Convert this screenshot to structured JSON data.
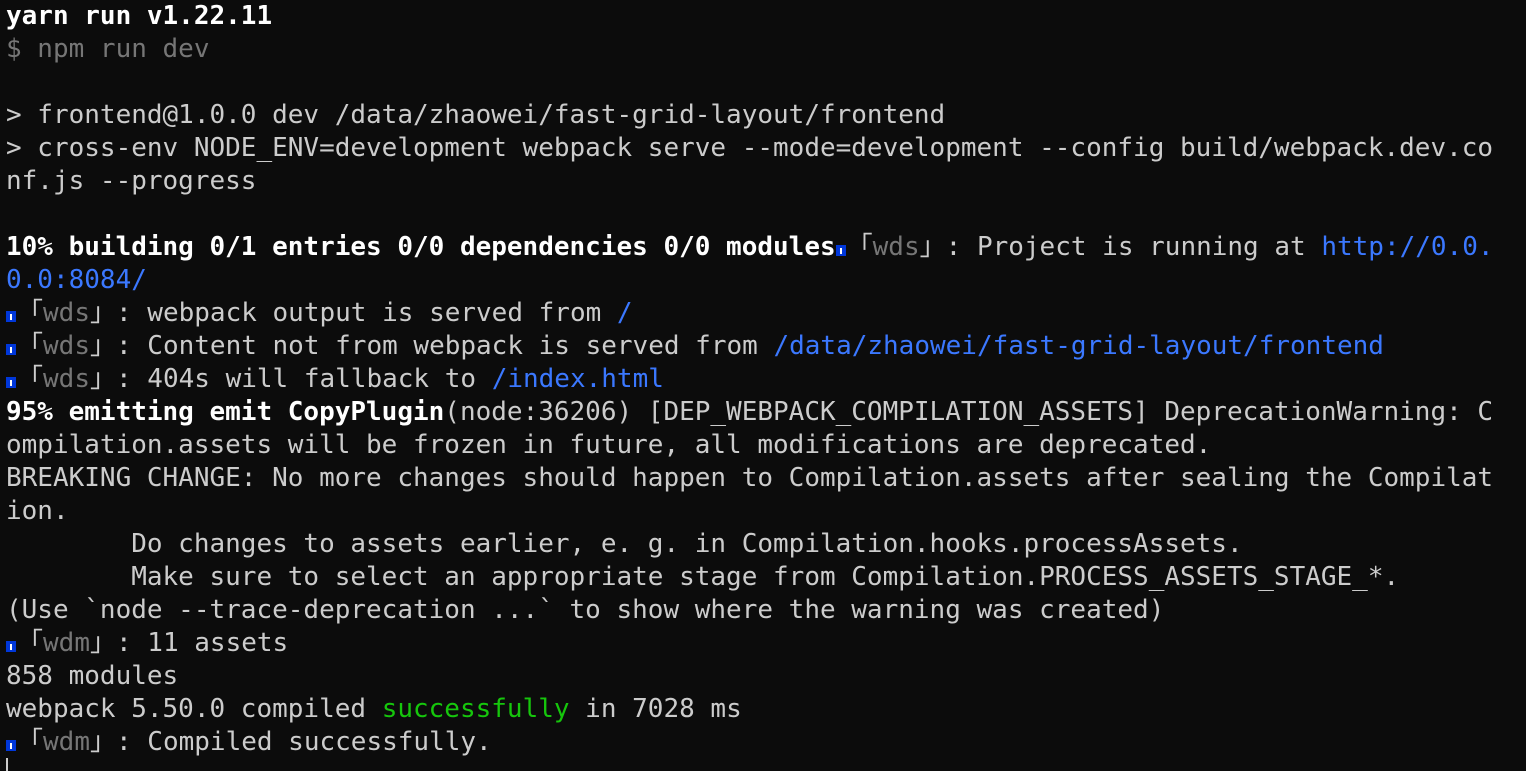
{
  "terminal": {
    "colors": {
      "background": "#0c0c0c",
      "text": "#cccccc",
      "link": "#3b78ff",
      "success": "#16c60c",
      "info_badge": "#0037da",
      "dim": "#767676"
    },
    "line1": "yarn run v1.22.11",
    "line2": "$ npm run dev",
    "line3": "> frontend@1.0.0 dev /data/zhaowei/fast-grid-layout/frontend",
    "line4": "> cross-env NODE_ENV=development webpack serve --mode=development --config build/webpack.dev.co",
    "line5": "nf.js --progress",
    "build_progress": "10% building 0/1 entries 0/0 dependencies 0/0 modules",
    "wds_tag": "wds",
    "wdm_tag": "wdm",
    "tag_open": "「",
    "tag_close": "」",
    "project_running_text": ": Project is running at ",
    "project_url_part1": "http://0.0.",
    "project_url_part2": "0.0:8084/",
    "served_from_text": ": webpack output is served from ",
    "served_from_path": "/",
    "content_text": ": Content not from webpack is served from ",
    "content_path": "/data/zhaowei/fast-grid-layout/frontend",
    "fallback_text": ": 404s will fallback to ",
    "fallback_path": "/index.html",
    "emit_prefix": "95% emitting emit CopyPlugin",
    "emit_rest": "(node:36206) [DEP_WEBPACK_COMPILATION_ASSETS] DeprecationWarning: C",
    "deprecation_line2": "ompilation.assets will be frozen in future, all modifications are deprecated.",
    "breaking_line1": "BREAKING CHANGE: No more changes should happen to Compilation.assets after sealing the Compilat",
    "breaking_line2": "ion.",
    "advice1": "        Do changes to assets earlier, e. g. in Compilation.hooks.processAssets.",
    "advice2": "        Make sure to select an appropriate stage from Compilation.PROCESS_ASSETS_STAGE_*.",
    "trace_line": "(Use `node --trace-deprecation ...` to show where the warning was created)",
    "assets_text": ": 11 assets",
    "modules_line": "858 modules",
    "compiled_prefix": "webpack 5.50.0 compiled ",
    "compiled_status": "successfully",
    "compiled_suffix": " in 7028 ms",
    "compiled_final": ": Compiled successfully.",
    "info_icon": "info-icon",
    "cursor_icon": "cursor-icon"
  }
}
